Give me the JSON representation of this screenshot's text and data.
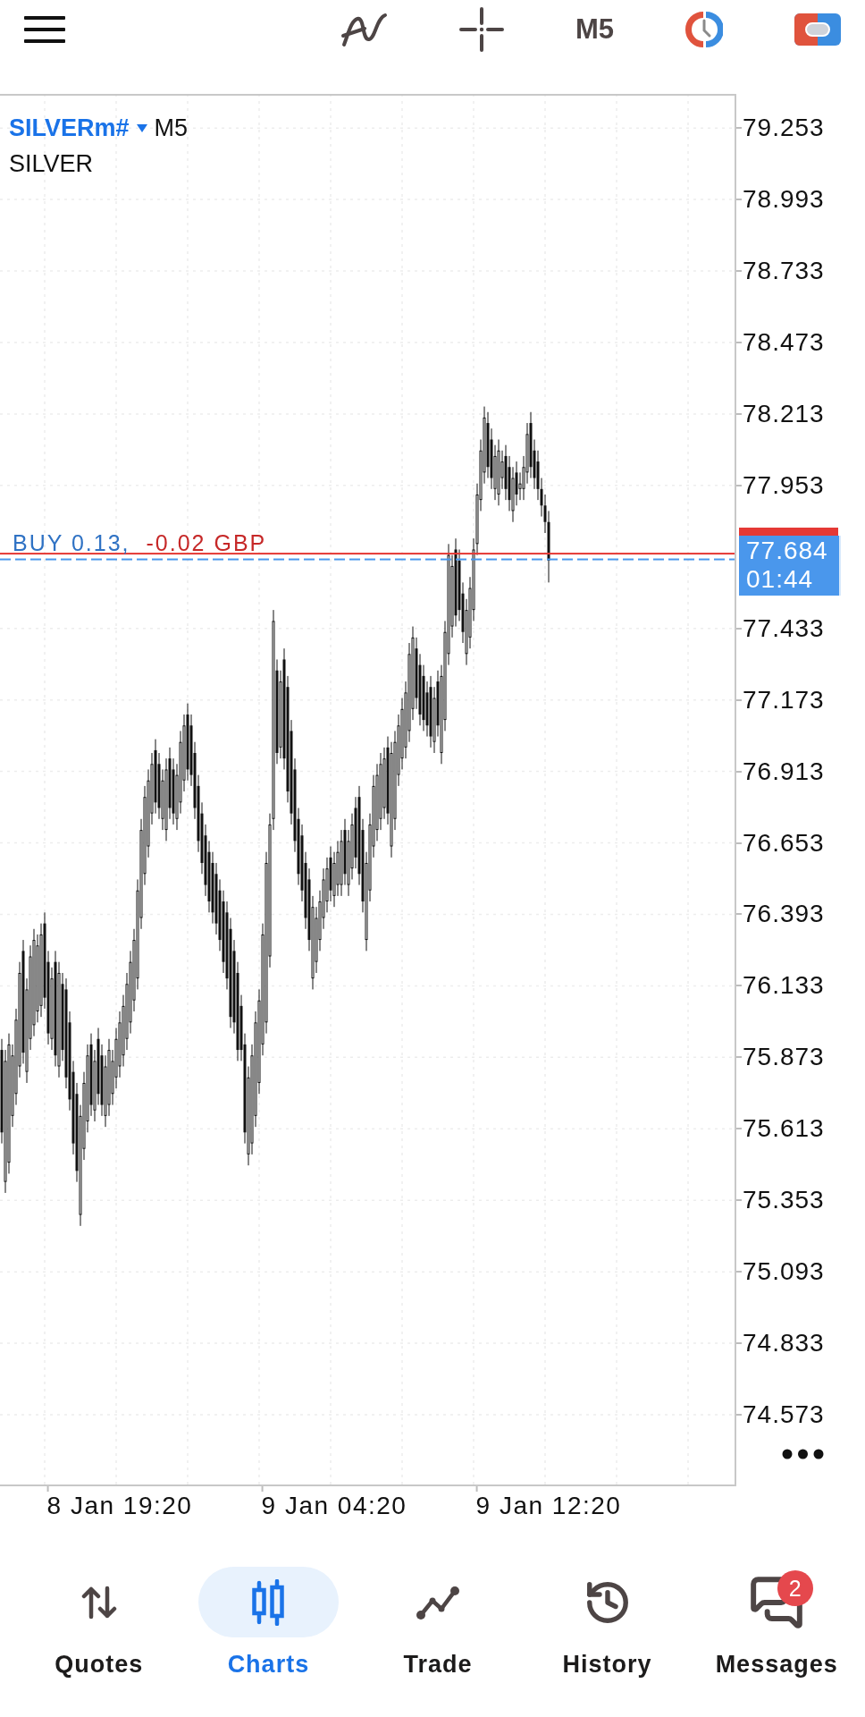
{
  "toolbar": {
    "timeframe": "M5"
  },
  "chart": {
    "symbol": "SILVERm#",
    "timeframe": "M5",
    "description": "SILVER",
    "order": "BUY 0.13,",
    "profit": "-0.02 GBP",
    "price_tag": {
      "price": "77.684",
      "countdown": "01:44"
    },
    "chart_data": {
      "type": "candlestick",
      "grid": true,
      "categories": [
        null,
        null,
        null,
        null,
        null,
        null,
        null,
        null,
        null,
        null,
        null,
        null,
        null,
        null,
        null,
        null,
        null,
        null,
        null,
        null,
        null,
        null,
        null,
        null,
        null,
        null,
        null,
        null,
        null,
        null,
        null,
        null,
        null,
        "8 Jan 19:20",
        null,
        null,
        null,
        null,
        null,
        null,
        null,
        null,
        null,
        null,
        null,
        null,
        null,
        null,
        null,
        null,
        null,
        null,
        null,
        null,
        null,
        null,
        null,
        null,
        null,
        null,
        null,
        null,
        null,
        null,
        null,
        null,
        null,
        null,
        null,
        null,
        null,
        null,
        null,
        null,
        null,
        null,
        null,
        null,
        null,
        null,
        null,
        null,
        null,
        null,
        null,
        null,
        null,
        null,
        null,
        null,
        null,
        null,
        null,
        "9 Jan 04:20",
        null,
        null,
        null,
        null,
        null,
        null,
        null,
        null,
        null,
        null,
        null,
        null,
        null,
        null,
        null,
        null,
        null,
        null,
        null,
        null,
        null,
        null,
        null,
        null,
        null,
        null,
        null,
        null,
        null,
        null,
        null,
        null,
        null,
        null,
        null,
        null,
        null,
        null,
        null,
        null,
        null,
        null,
        null,
        null,
        null,
        null,
        null,
        null,
        null,
        null,
        null,
        null,
        null,
        null,
        null,
        null,
        null,
        null,
        null,
        "9 Jan 12:20",
        null,
        null,
        null,
        null,
        null,
        null,
        null,
        null,
        null,
        null,
        null,
        null,
        null,
        null,
        null,
        null,
        null,
        null,
        null,
        null,
        null,
        null,
        null,
        null,
        null,
        null,
        null,
        null,
        null,
        null,
        null,
        null,
        null,
        null,
        null,
        null,
        null,
        null,
        null,
        null,
        null,
        null,
        null,
        null,
        null,
        null,
        null,
        null,
        null,
        null,
        null,
        null
      ],
      "ohlc": [
        [
          75.9,
          75.94,
          75.56,
          75.6
        ],
        [
          75.42,
          75.9,
          75.38,
          75.86
        ],
        [
          75.49,
          75.96,
          75.45,
          75.92
        ],
        [
          75.66,
          75.92,
          75.62,
          75.88
        ],
        [
          75.74,
          76.05,
          75.7,
          76.01
        ],
        [
          75.84,
          76.22,
          75.8,
          76.18
        ],
        [
          76.26,
          76.3,
          75.85,
          75.89
        ],
        [
          75.82,
          76.16,
          75.78,
          76.12
        ],
        [
          75.94,
          76.28,
          75.9,
          76.24
        ],
        [
          75.99,
          76.34,
          75.95,
          76.3
        ],
        [
          76.04,
          76.32,
          76.0,
          76.28
        ],
        [
          76.06,
          76.36,
          76.02,
          76.32
        ],
        [
          76.36,
          76.4,
          76.05,
          76.09
        ],
        [
          76.22,
          76.26,
          75.92,
          75.96
        ],
        [
          75.94,
          76.2,
          75.9,
          76.16
        ],
        [
          76.22,
          76.26,
          75.84,
          75.88
        ],
        [
          75.84,
          76.22,
          75.8,
          76.18
        ],
        [
          76.14,
          76.18,
          75.86,
          75.9
        ],
        [
          76.12,
          76.16,
          75.76,
          75.8
        ],
        [
          76.0,
          76.04,
          75.68,
          75.72
        ],
        [
          75.82,
          75.86,
          75.52,
          75.56
        ],
        [
          75.74,
          75.78,
          75.42,
          75.46
        ],
        [
          75.3,
          75.7,
          75.26,
          75.66
        ],
        [
          75.54,
          75.82,
          75.5,
          75.78
        ],
        [
          75.64,
          75.92,
          75.6,
          75.88
        ],
        [
          75.92,
          75.96,
          75.66,
          75.7
        ],
        [
          75.68,
          75.9,
          75.64,
          75.86
        ],
        [
          75.94,
          75.98,
          75.7,
          75.74
        ],
        [
          75.88,
          75.92,
          75.66,
          75.7
        ],
        [
          75.66,
          75.88,
          75.62,
          75.84
        ],
        [
          75.7,
          75.94,
          75.66,
          75.9
        ],
        [
          75.74,
          75.9,
          75.7,
          75.86
        ],
        [
          75.8,
          75.98,
          75.76,
          75.94
        ],
        [
          75.84,
          76.04,
          75.8,
          76.0
        ],
        [
          75.88,
          76.1,
          75.84,
          76.06
        ],
        [
          75.94,
          76.18,
          75.9,
          76.14
        ],
        [
          76.0,
          76.26,
          75.96,
          76.22
        ],
        [
          76.08,
          76.34,
          76.04,
          76.3
        ],
        [
          76.16,
          76.52,
          76.12,
          76.48
        ],
        [
          76.38,
          76.74,
          76.34,
          76.7
        ],
        [
          76.54,
          76.86,
          76.5,
          76.82
        ],
        [
          76.64,
          76.92,
          76.6,
          76.88
        ],
        [
          76.76,
          76.98,
          76.72,
          76.94
        ],
        [
          76.99,
          77.03,
          76.76,
          76.8
        ],
        [
          76.94,
          76.98,
          76.74,
          76.78
        ],
        [
          76.74,
          76.92,
          76.7,
          76.88
        ],
        [
          76.7,
          76.96,
          76.66,
          76.92
        ],
        [
          76.96,
          77.0,
          76.74,
          76.78
        ],
        [
          76.92,
          76.96,
          76.72,
          76.76
        ],
        [
          76.74,
          76.94,
          76.7,
          76.9
        ],
        [
          76.8,
          77.06,
          76.76,
          77.02
        ],
        [
          76.88,
          77.12,
          76.84,
          77.08
        ],
        [
          77.12,
          77.16,
          76.88,
          76.92
        ],
        [
          77.08,
          77.12,
          76.86,
          76.9
        ],
        [
          76.98,
          77.02,
          76.74,
          76.78
        ],
        [
          76.86,
          76.9,
          76.62,
          76.66
        ],
        [
          76.76,
          76.8,
          76.54,
          76.58
        ],
        [
          76.68,
          76.72,
          76.46,
          76.5
        ],
        [
          76.62,
          76.66,
          76.4,
          76.44
        ],
        [
          76.58,
          76.62,
          76.36,
          76.4
        ],
        [
          76.54,
          76.58,
          76.32,
          76.36
        ],
        [
          76.48,
          76.52,
          76.26,
          76.3
        ],
        [
          76.44,
          76.48,
          76.18,
          76.22
        ],
        [
          76.4,
          76.44,
          76.12,
          76.16
        ],
        [
          76.34,
          76.38,
          75.98,
          76.02
        ],
        [
          76.26,
          76.3,
          75.96,
          76.0
        ],
        [
          76.18,
          76.22,
          75.86,
          75.9
        ],
        [
          76.06,
          76.1,
          75.86,
          75.9
        ],
        [
          75.92,
          75.96,
          75.56,
          75.6
        ],
        [
          75.52,
          75.84,
          75.48,
          75.8
        ],
        [
          75.56,
          75.92,
          75.52,
          75.88
        ],
        [
          75.66,
          76.04,
          75.62,
          76.0
        ],
        [
          75.78,
          76.12,
          75.74,
          76.08
        ],
        [
          75.92,
          76.36,
          75.88,
          76.32
        ],
        [
          76.0,
          76.62,
          75.96,
          76.58
        ],
        [
          76.24,
          76.76,
          76.2,
          76.72
        ],
        [
          76.74,
          77.5,
          76.7,
          77.46
        ],
        [
          77.28,
          77.32,
          76.94,
          76.98
        ],
        [
          77.0,
          77.28,
          76.96,
          77.24
        ],
        [
          77.32,
          77.36,
          76.92,
          76.96
        ],
        [
          77.22,
          77.26,
          76.8,
          76.84
        ],
        [
          77.06,
          77.1,
          76.72,
          76.76
        ],
        [
          76.92,
          76.96,
          76.62,
          76.66
        ],
        [
          76.74,
          76.78,
          76.5,
          76.54
        ],
        [
          76.68,
          76.72,
          76.44,
          76.48
        ],
        [
          76.58,
          76.62,
          76.34,
          76.38
        ],
        [
          76.52,
          76.56,
          76.26,
          76.3
        ],
        [
          76.16,
          76.46,
          76.12,
          76.42
        ],
        [
          76.22,
          76.42,
          76.18,
          76.38
        ],
        [
          76.3,
          76.48,
          76.26,
          76.44
        ],
        [
          76.38,
          76.56,
          76.34,
          76.52
        ],
        [
          76.44,
          76.6,
          76.4,
          76.56
        ],
        [
          76.6,
          76.64,
          76.44,
          76.48
        ],
        [
          76.46,
          76.62,
          76.42,
          76.58
        ],
        [
          76.5,
          76.66,
          76.46,
          76.62
        ],
        [
          76.5,
          76.7,
          76.46,
          76.66
        ],
        [
          76.7,
          76.74,
          76.5,
          76.54
        ],
        [
          76.5,
          76.7,
          76.46,
          76.66
        ],
        [
          76.56,
          76.76,
          76.52,
          76.72
        ],
        [
          76.78,
          76.82,
          76.56,
          76.6
        ],
        [
          76.82,
          76.86,
          76.5,
          76.54
        ],
        [
          76.7,
          76.74,
          76.4,
          76.44
        ],
        [
          76.3,
          76.62,
          76.26,
          76.58
        ],
        [
          76.48,
          76.76,
          76.44,
          76.72
        ],
        [
          76.64,
          76.9,
          76.6,
          76.86
        ],
        [
          76.7,
          76.94,
          76.66,
          76.9
        ],
        [
          76.74,
          76.98,
          76.7,
          76.94
        ],
        [
          76.78,
          77.0,
          76.74,
          76.96
        ],
        [
          77.0,
          77.04,
          76.72,
          76.76
        ],
        [
          76.64,
          77.02,
          76.6,
          76.98
        ],
        [
          76.74,
          77.06,
          76.7,
          77.02
        ],
        [
          76.9,
          77.12,
          76.86,
          77.08
        ],
        [
          76.96,
          77.18,
          76.92,
          77.14
        ],
        [
          77.0,
          77.24,
          76.96,
          77.2
        ],
        [
          77.06,
          77.38,
          77.02,
          77.34
        ],
        [
          77.14,
          77.44,
          77.1,
          77.4
        ],
        [
          77.36,
          77.4,
          77.14,
          77.18
        ],
        [
          77.3,
          77.34,
          77.08,
          77.12
        ],
        [
          77.26,
          77.3,
          77.06,
          77.1
        ],
        [
          77.2,
          77.24,
          77.04,
          77.08
        ],
        [
          77.22,
          77.26,
          77.0,
          77.04
        ],
        [
          77.02,
          77.22,
          76.98,
          77.18
        ],
        [
          77.24,
          77.28,
          77.04,
          77.08
        ],
        [
          76.98,
          77.3,
          76.94,
          77.26
        ],
        [
          77.1,
          77.46,
          77.06,
          77.42
        ],
        [
          77.34,
          77.74,
          77.3,
          77.7
        ],
        [
          77.44,
          77.7,
          77.4,
          77.66
        ],
        [
          77.72,
          77.76,
          77.44,
          77.48
        ],
        [
          77.68,
          77.72,
          77.46,
          77.5
        ],
        [
          77.56,
          77.6,
          77.38,
          77.42
        ],
        [
          77.34,
          77.54,
          77.3,
          77.5
        ],
        [
          77.4,
          77.62,
          77.36,
          77.58
        ],
        [
          77.5,
          77.76,
          77.46,
          77.72
        ],
        [
          77.74,
          77.96,
          77.7,
          77.92
        ],
        [
          77.9,
          78.12,
          77.86,
          78.08
        ],
        [
          78.0,
          78.24,
          77.96,
          78.2
        ],
        [
          78.18,
          78.22,
          77.98,
          78.02
        ],
        [
          78.12,
          78.16,
          77.94,
          77.98
        ],
        [
          77.94,
          78.1,
          77.9,
          78.06
        ],
        [
          77.92,
          78.12,
          77.88,
          78.08
        ],
        [
          77.98,
          78.08,
          77.94,
          78.04
        ],
        [
          78.06,
          78.1,
          77.9,
          77.94
        ],
        [
          78.02,
          78.06,
          77.86,
          77.9
        ],
        [
          77.86,
          78.02,
          77.82,
          77.98
        ],
        [
          78.0,
          78.04,
          77.88,
          77.92
        ],
        [
          77.94,
          78.0,
          77.9,
          77.96
        ],
        [
          77.94,
          78.06,
          77.9,
          78.02
        ],
        [
          78.0,
          78.18,
          77.96,
          78.14
        ],
        [
          78.18,
          78.22,
          77.98,
          78.02
        ],
        [
          78.08,
          78.12,
          77.94,
          77.98
        ],
        [
          78.04,
          78.08,
          77.9,
          77.94
        ],
        [
          77.94,
          77.98,
          77.84,
          77.88
        ],
        [
          77.88,
          77.92,
          77.78,
          77.82
        ],
        [
          77.82,
          77.86,
          77.6,
          77.68
        ],
        null,
        null,
        null,
        null,
        null,
        null,
        null,
        null,
        null,
        null,
        null,
        null,
        null,
        null,
        null,
        null,
        null,
        null,
        null,
        null,
        null,
        null,
        null,
        null,
        null,
        null,
        null,
        null,
        null,
        null,
        null,
        null,
        null,
        null,
        null,
        null,
        null,
        null,
        null,
        null,
        null,
        null,
        null,
        null,
        null,
        null,
        null,
        null,
        null,
        null,
        null,
        null
      ],
      "ylim": [
        74.313,
        79.377
      ],
      "yticks": [
        79.253,
        78.993,
        78.733,
        78.473,
        78.213,
        77.953,
        77.433,
        77.173,
        76.913,
        76.653,
        76.393,
        76.133,
        75.873,
        75.613,
        75.353,
        75.093,
        74.833,
        74.573
      ],
      "ref_lines": [
        {
          "axis": "y",
          "value": 77.705
        },
        {
          "axis": "y",
          "value": 77.684
        }
      ]
    }
  },
  "nav": {
    "items": [
      {
        "label": "Quotes",
        "selected": false
      },
      {
        "label": "Charts",
        "selected": true
      },
      {
        "label": "Trade",
        "selected": false
      },
      {
        "label": "History",
        "selected": false
      },
      {
        "label": "Messages",
        "selected": false,
        "badge": "2"
      }
    ]
  }
}
